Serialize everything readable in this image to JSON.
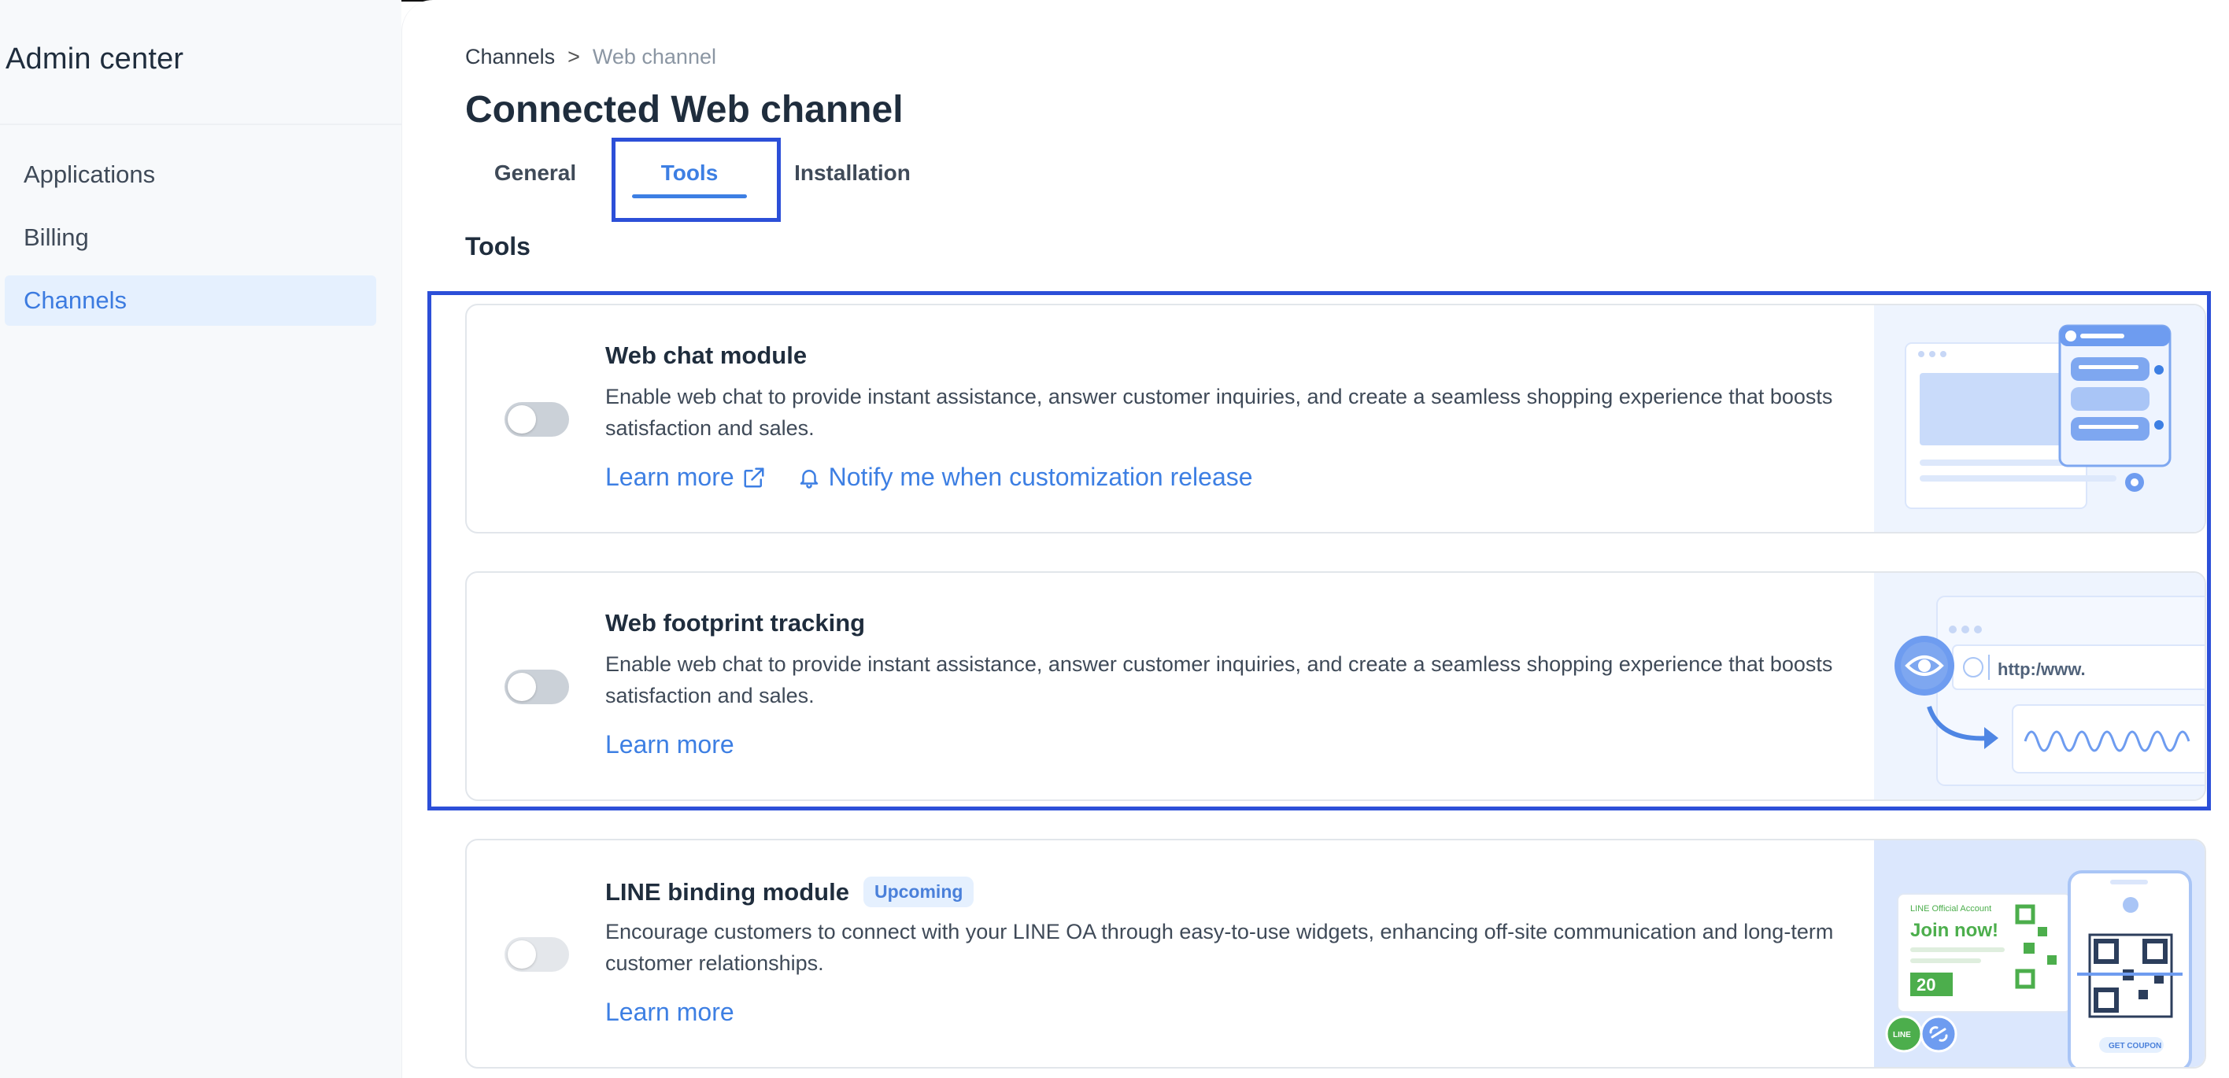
{
  "sidebar": {
    "title": "Admin center",
    "items": [
      {
        "label": "Applications",
        "active": false
      },
      {
        "label": "Billing",
        "active": false
      },
      {
        "label": "Channels",
        "active": true
      }
    ]
  },
  "breadcrumb": {
    "parent": "Channels",
    "separator": ">",
    "current": "Web channel"
  },
  "page": {
    "title": "Connected Web channel"
  },
  "tabs": [
    {
      "label": "General",
      "active": false
    },
    {
      "label": "Tools",
      "active": true
    },
    {
      "label": "Installation",
      "active": false
    }
  ],
  "section": {
    "title": "Tools"
  },
  "cards": [
    {
      "title": "Web chat module",
      "description": "Enable web chat to provide instant assistance, answer customer inquiries, and create a seamless shopping experience that boosts satisfaction and sales.",
      "toggle_on": false,
      "learn_more": "Learn more",
      "notify": "Notify me when customization release"
    },
    {
      "title": "Web footprint tracking",
      "description": "Enable web chat to provide instant assistance, answer customer inquiries, and create a seamless shopping experience that boosts satisfaction and sales.",
      "toggle_on": false,
      "learn_more": "Learn more",
      "illus_url_text": "http:/www."
    },
    {
      "title": "LINE binding module",
      "badge": "Upcoming",
      "description": "Encourage customers to connect with your LINE OA through easy-to-use widgets, enhancing off-site communication and long-term customer relationships.",
      "toggle_on": false,
      "learn_more": "Learn more",
      "illus_header": "LINE Official Account",
      "illus_join": "Join now!",
      "illus_discount": "20",
      "illus_coupon": "GET COUPON",
      "illus_line_logo": "LINE"
    }
  ],
  "colors": {
    "accent": "#3d7fe3",
    "highlight_box": "#2c4fd8",
    "active_nav_bg": "#e5f0fe"
  }
}
